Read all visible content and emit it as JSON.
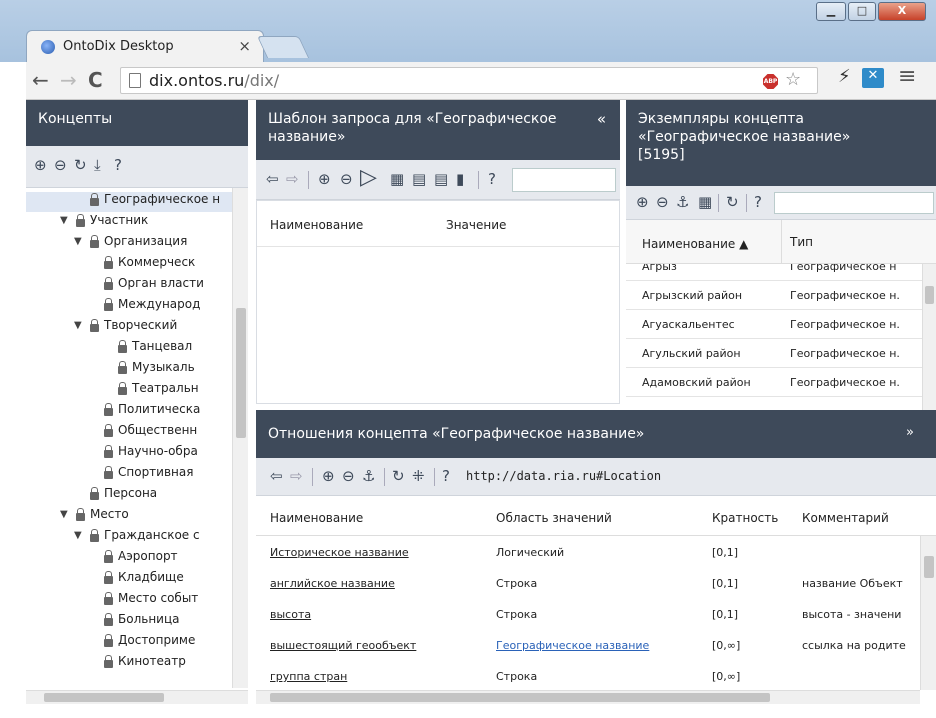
{
  "browser": {
    "tab_title": "OntoDix Desktop",
    "tab_close": "×",
    "url_host": "dix.ontos.ru",
    "url_path": "/dix/",
    "abp": "ABP",
    "win_minimize": "▁",
    "win_maximize": "□",
    "win_close": "X"
  },
  "concepts_panel": {
    "title": "Концепты",
    "tree": [
      {
        "label": "Географическое н",
        "level": 1,
        "selected": true
      },
      {
        "label": "Участник",
        "level": 0,
        "expanded": true
      },
      {
        "label": "Организация",
        "level": 1,
        "expanded": true
      },
      {
        "label": "Коммерческ",
        "level": 2
      },
      {
        "label": "Орган власти",
        "level": 2
      },
      {
        "label": "Международ",
        "level": 2
      },
      {
        "label": "Творческий",
        "level": 1,
        "expanded": true
      },
      {
        "label": "Танцевал",
        "level": 3
      },
      {
        "label": "Музыкаль",
        "level": 3
      },
      {
        "label": "Театральн",
        "level": 3
      },
      {
        "label": "Политическа",
        "level": 2
      },
      {
        "label": "Общественн",
        "level": 2
      },
      {
        "label": "Научно-обра",
        "level": 2
      },
      {
        "label": "Спортивная",
        "level": 2
      },
      {
        "label": "Персона",
        "level": 1
      },
      {
        "label": "Место",
        "level": 0,
        "expanded": true
      },
      {
        "label": "Гражданское с",
        "level": 1,
        "expanded": true
      },
      {
        "label": "Аэропорт",
        "level": 2
      },
      {
        "label": "Кладбище",
        "level": 2
      },
      {
        "label": "Место событ",
        "level": 2
      },
      {
        "label": "Больница",
        "level": 2
      },
      {
        "label": "Достоприме",
        "level": 2
      },
      {
        "label": "Кинотеатр",
        "level": 2
      }
    ]
  },
  "query_panel": {
    "title_line1": "Шаблон запроса для «Географическое",
    "title_line2": "название»",
    "collapse": "«",
    "col_name": "Наименование",
    "col_value": "Значение"
  },
  "instances_panel": {
    "title_line1": "Экземпляры концепта",
    "title_line2": "«Географическое название»",
    "title_line3": "[5195]",
    "col_name": "Наименование ▲",
    "col_type": "Тип",
    "rows": [
      {
        "name": "Агрыз",
        "type": "Географическое н"
      },
      {
        "name": "Агрызский район",
        "type": "Географическое н."
      },
      {
        "name": "Агуаскальентес",
        "type": "Географическое н."
      },
      {
        "name": "Агульский район",
        "type": "Географическое н."
      },
      {
        "name": "Адамовский район",
        "type": "Географическое н."
      }
    ]
  },
  "relations_panel": {
    "title": "Отношения концепта «Географическое название»",
    "expand": "»",
    "uri": "http://data.ria.ru#Location",
    "col_name": "Наименование",
    "col_range": "Область значений",
    "col_card": "Кратность",
    "col_comment": "Комментарий",
    "rows": [
      {
        "name": "Историческое название",
        "range": "Логический",
        "range_link": false,
        "card": "[0,1]",
        "comment": ""
      },
      {
        "name": "английское название",
        "range": "Строка",
        "range_link": false,
        "card": "[0,1]",
        "comment": "название Объект"
      },
      {
        "name": "высота",
        "range": "Строка",
        "range_link": false,
        "card": "[0,1]",
        "comment": "высота - значени"
      },
      {
        "name": "вышестоящий геообъект",
        "range": "Географическое название",
        "range_link": true,
        "card": "[0,∞]",
        "comment": "ссылка на родите"
      },
      {
        "name": "группа стран",
        "range": "Строка",
        "range_link": false,
        "card": "[0,∞]",
        "comment": ""
      }
    ]
  }
}
